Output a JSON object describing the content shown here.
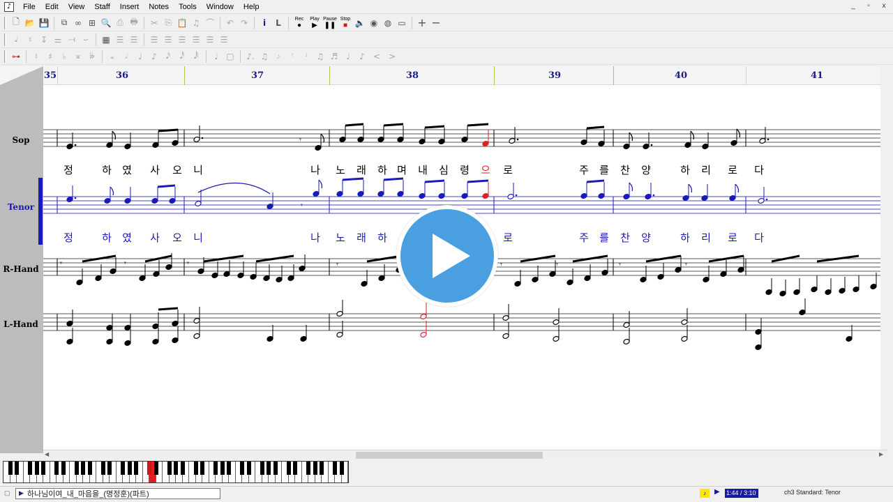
{
  "menubar": {
    "app_icon": "music-app-icon",
    "items": [
      "File",
      "Edit",
      "View",
      "Staff",
      "Insert",
      "Notes",
      "Tools",
      "Window",
      "Help"
    ],
    "window_controls": [
      "_",
      "▫",
      "x"
    ]
  },
  "toolbar": {
    "play_label": "Play",
    "pause_label": "Pause",
    "stop_label": "Stop",
    "rec_label": "Rec"
  },
  "measures": [
    "35",
    "36",
    "37",
    "38",
    "39",
    "40",
    "41"
  ],
  "staves": {
    "sop": {
      "label": "Sop"
    },
    "tenor": {
      "label": "Tenor"
    },
    "rhand": {
      "label": "R-Hand"
    },
    "lhand": {
      "label": "L-Hand"
    }
  },
  "lyrics": {
    "sop": [
      "정",
      "하",
      "였",
      "사",
      "오",
      "니",
      "나",
      "노",
      "래",
      "하",
      "며",
      "내",
      "심",
      "령",
      "으",
      "로",
      "주",
      "를",
      "찬",
      "양",
      "하",
      "리",
      "로",
      "다"
    ],
    "tenor": [
      "정",
      "하",
      "였",
      "사",
      "오",
      "니",
      "나",
      "노",
      "래",
      "하",
      "로",
      "주",
      "를",
      "찬",
      "양",
      "하",
      "리",
      "로",
      "다"
    ]
  },
  "colors": {
    "measure_number": "#1a1a8c",
    "tenor": "#1a1ab8",
    "highlight": "#e02020"
  },
  "status": {
    "file_name": "하나님이여_내_마음을_(명정훈)(파트)",
    "time": "1:44 / 3:10",
    "staff_info": "ch3 Standard: Tenor"
  },
  "overlay": {
    "icon": "play-icon"
  }
}
